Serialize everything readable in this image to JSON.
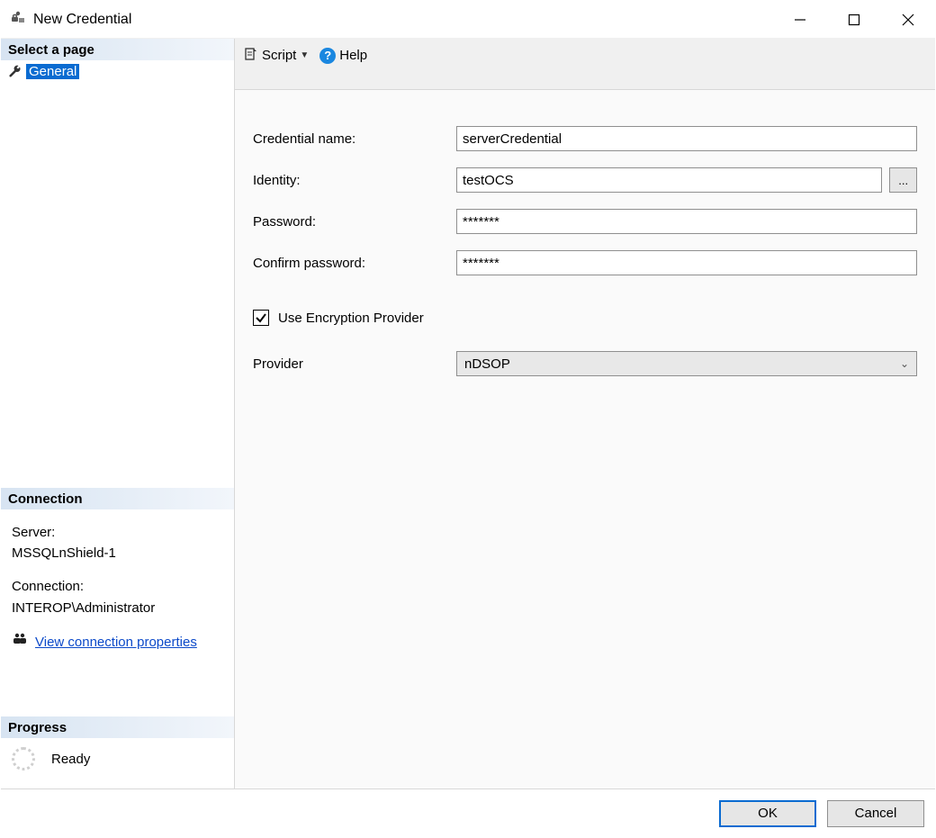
{
  "window": {
    "title": "New Credential"
  },
  "sidebar": {
    "select_header": "Select a page",
    "pages": [
      {
        "label": "General",
        "selected": true
      }
    ],
    "connection_header": "Connection",
    "connection": {
      "server_label": "Server:",
      "server_value": "MSSQLnShield-1",
      "conn_label": "Connection:",
      "conn_value": "INTEROP\\Administrator",
      "view_props_link": "View connection properties"
    },
    "progress_header": "Progress",
    "progress_status": "Ready"
  },
  "toolbar": {
    "script_label": "Script",
    "help_label": "Help"
  },
  "form": {
    "cred_name_label": "Credential name:",
    "cred_name_value": "serverCredential",
    "identity_label": "Identity:",
    "identity_value": "testOCS",
    "browse_label": "...",
    "password_label": "Password:",
    "password_value": "*******",
    "confirm_label": "Confirm password:",
    "confirm_value": "*******",
    "use_enc_label": "Use Encryption Provider",
    "use_enc_checked": true,
    "provider_label": "Provider",
    "provider_value": "nDSOP"
  },
  "footer": {
    "ok_label": "OK",
    "cancel_label": "Cancel"
  }
}
